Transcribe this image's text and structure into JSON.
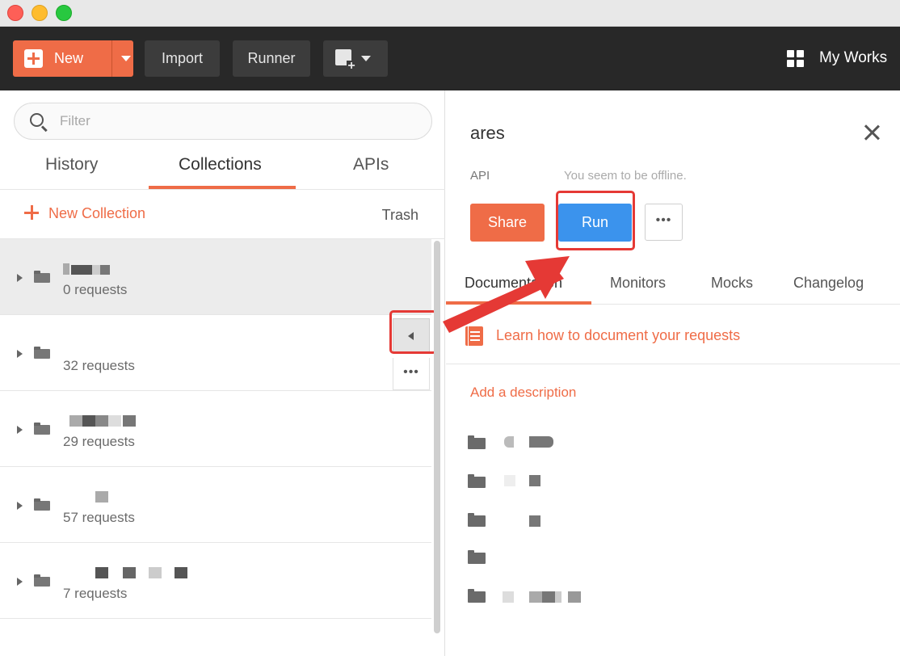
{
  "window": {
    "title": ""
  },
  "toolbar": {
    "new_label": "New",
    "import_label": "Import",
    "runner_label": "Runner",
    "workspace_label": "My Works"
  },
  "sidebar": {
    "filter_placeholder": "Filter",
    "tabs": [
      {
        "label": "History"
      },
      {
        "label": "Collections"
      },
      {
        "label": "APIs"
      }
    ],
    "active_tab": "Collections",
    "new_collection_label": "New Collection",
    "trash_label": "Trash",
    "collections": [
      {
        "requests": "0 requests"
      },
      {
        "requests": "32 requests"
      },
      {
        "requests": "29 requests"
      },
      {
        "requests": "57 requests"
      },
      {
        "requests": "7 requests"
      }
    ]
  },
  "detail": {
    "api_name": "ares",
    "api_type": "API",
    "status_text": "You seem to be offline.",
    "share_label": "Share",
    "run_label": "Run",
    "tabs": [
      {
        "label": "Documentation"
      },
      {
        "label": "Monitors"
      },
      {
        "label": "Mocks"
      },
      {
        "label": "Changelog"
      }
    ],
    "learn_link": "Learn how to document your requests",
    "add_description": "Add a description"
  },
  "colors": {
    "accent": "#ef6c47",
    "run_blue": "#3b93ed",
    "toolbar_bg": "#282828",
    "highlight_red": "#e53935"
  }
}
